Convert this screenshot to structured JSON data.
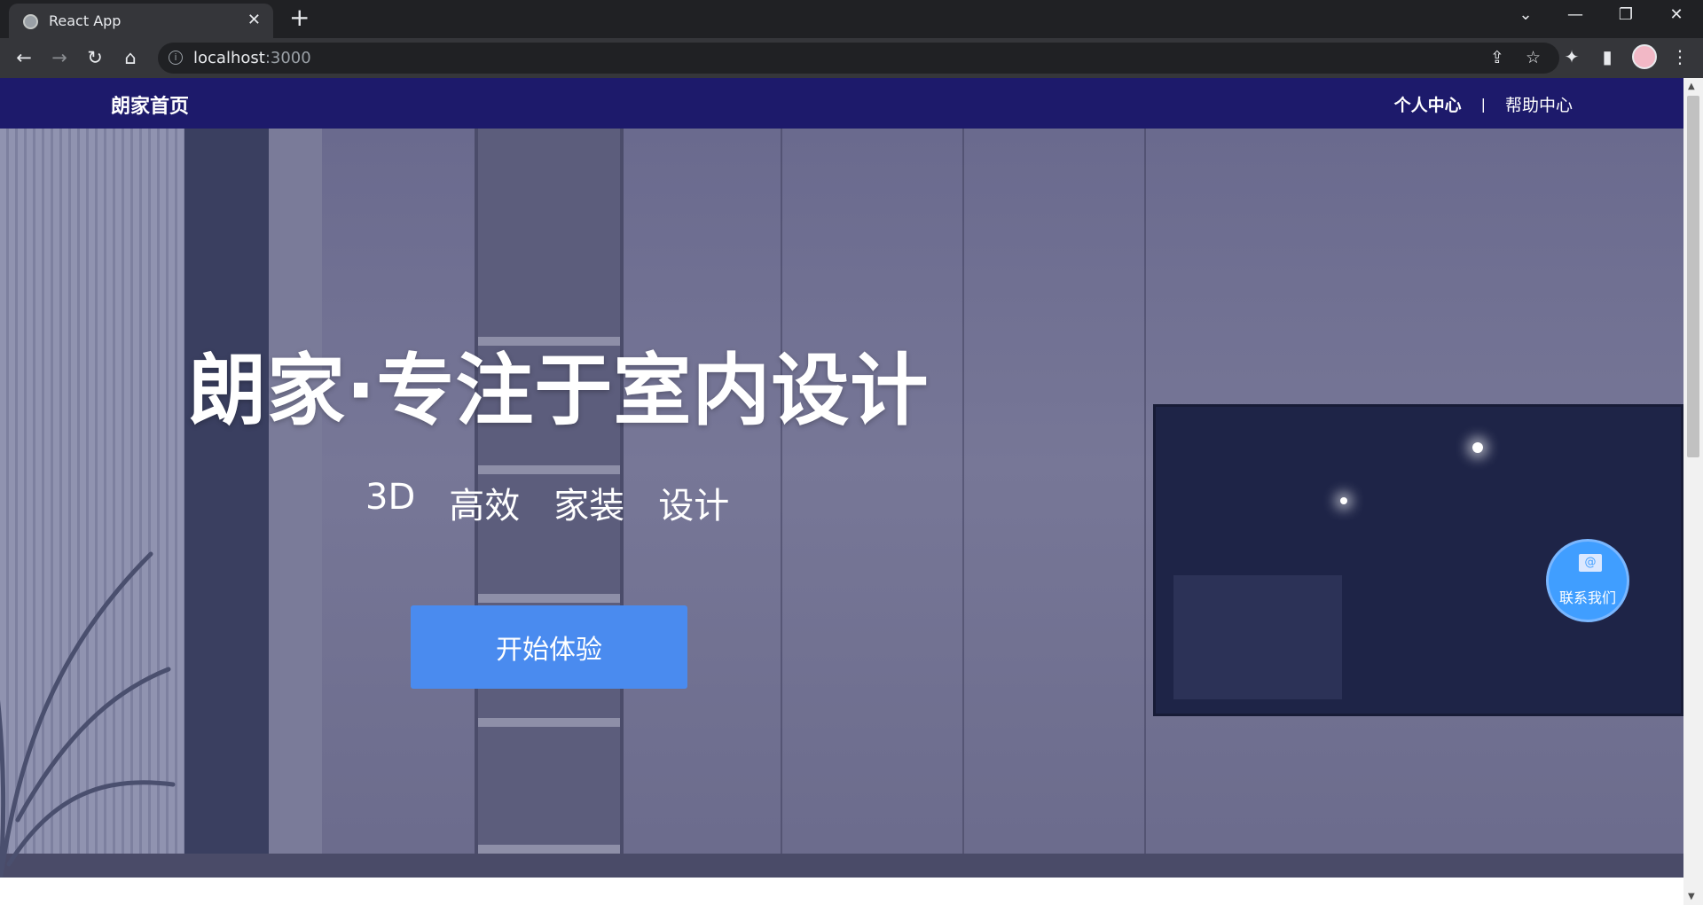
{
  "browser": {
    "tab_title": "React App",
    "tab_close": "✕",
    "new_tab": "+",
    "url_host": "localhost",
    "url_port": ":3000",
    "controls": {
      "dropdown": "⌄",
      "minimize": "—",
      "restore": "❐",
      "close": "✕"
    },
    "nav": {
      "back": "←",
      "forward": "→",
      "reload": "↻",
      "home": "⌂"
    },
    "icons": {
      "share": "⇪",
      "bookmark": "☆",
      "extensions": "✦",
      "sidepanel": "▮",
      "menu": "⋮",
      "info": "i"
    }
  },
  "navbar": {
    "brand": "朗家首页",
    "links": [
      {
        "label": "个人中心"
      },
      {
        "label": "帮助中心"
      }
    ],
    "separator": "|"
  },
  "hero": {
    "title": "朗家·专注于室内设计",
    "tags": [
      "3D",
      "高效",
      "家装",
      "设计"
    ],
    "cta_label": "开始体验"
  },
  "contact": {
    "label": "联系我们",
    "icon_glyph": "@"
  },
  "scrollbar": {
    "up": "▲",
    "down": "▼"
  },
  "colors": {
    "navbar_bg": "#1d1a6b",
    "cta_bg": "#4a8bef",
    "contact_bg": "#409eff"
  }
}
